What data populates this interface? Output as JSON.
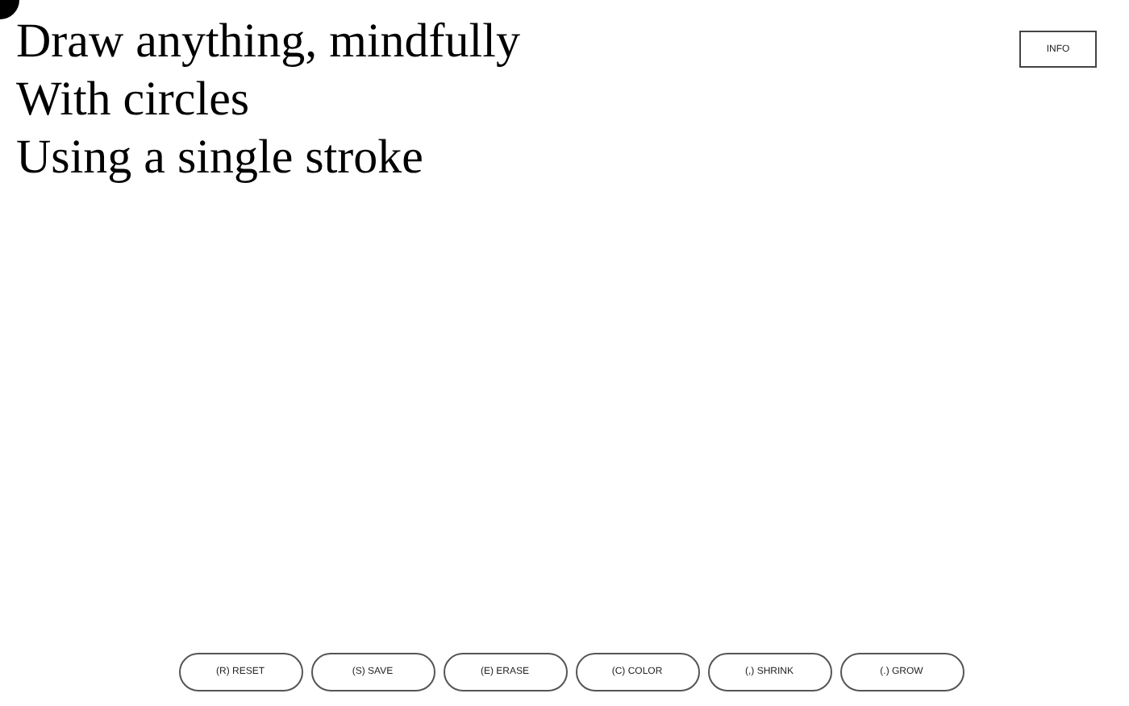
{
  "title_lines": [
    "Draw anything, mindfully",
    "With circles",
    "Using a single stroke"
  ],
  "info_button": "INFO",
  "buttons": [
    "(R) RESET",
    "(S) SAVE",
    "(E) ERASE",
    "(C) COLOR",
    "(,) SHRINK",
    "(.) GROW"
  ]
}
